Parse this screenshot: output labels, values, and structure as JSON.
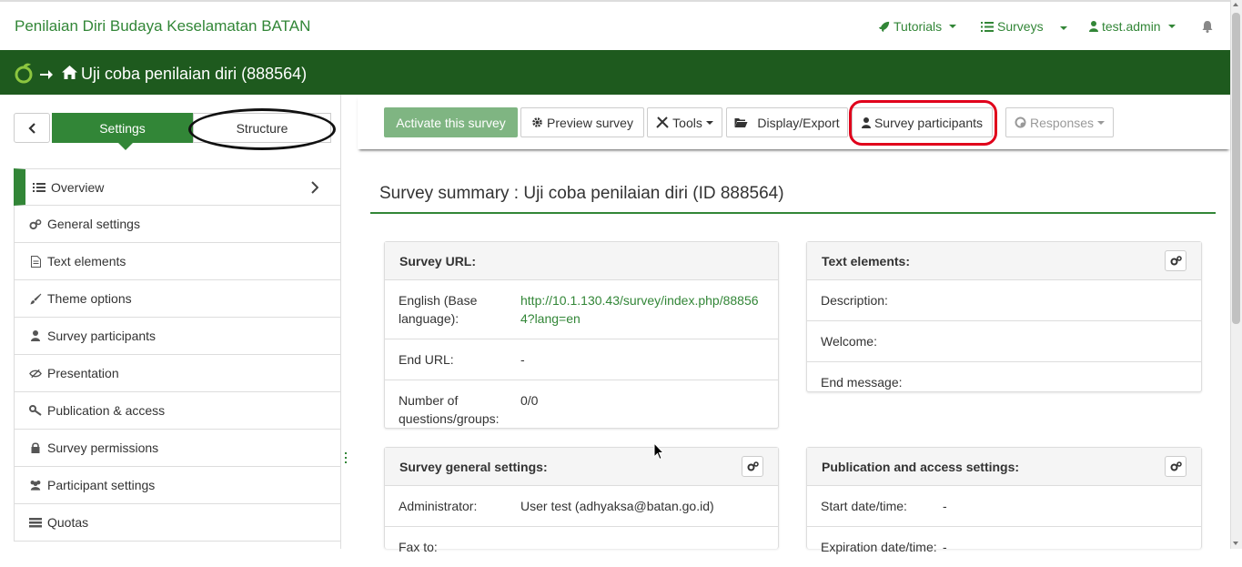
{
  "topbar": {
    "brand": "Penilaian Diri Budaya Keselamatan BATAN",
    "tutorials": "Tutorials",
    "surveys": "Surveys",
    "user": "test.admin"
  },
  "header": {
    "title": "Uji coba penilaian diri (888564)"
  },
  "sidebar": {
    "tab_settings": "Settings",
    "tab_structure": "Structure",
    "items": [
      {
        "label": "Overview",
        "icon": "list-icon"
      },
      {
        "label": "General settings",
        "icon": "gears-icon"
      },
      {
        "label": "Text elements",
        "icon": "file-text-icon"
      },
      {
        "label": "Theme options",
        "icon": "paint-brush-icon"
      },
      {
        "label": "Survey participants",
        "icon": "user-icon"
      },
      {
        "label": "Presentation",
        "icon": "eye-slash-icon"
      },
      {
        "label": "Publication & access",
        "icon": "key-icon"
      },
      {
        "label": "Survey permissions",
        "icon": "lock-icon"
      },
      {
        "label": "Participant settings",
        "icon": "users-icon"
      },
      {
        "label": "Quotas",
        "icon": "tasks-icon"
      }
    ]
  },
  "toolbar": {
    "activate": "Activate this survey",
    "preview": "Preview survey",
    "tools": "Tools",
    "display_export": "Display/Export",
    "survey_participants": "Survey participants",
    "responses": "Responses"
  },
  "summary": {
    "title": "Survey summary : Uji coba penilaian diri (ID 888564)",
    "survey_url": {
      "heading": "Survey URL:",
      "rows": [
        {
          "key": "English (Base language):",
          "value": "http://10.1.130.43/survey/index.php/888564?lang=en"
        },
        {
          "key": "End URL:",
          "value": "-"
        },
        {
          "key": "Number of questions/groups:",
          "value": "0/0"
        }
      ]
    },
    "text_elements": {
      "heading": "Text elements:",
      "rows": [
        {
          "key": "Description:",
          "value": ""
        },
        {
          "key": "Welcome:",
          "value": ""
        },
        {
          "key": "End message:",
          "value": ""
        }
      ]
    },
    "general_settings": {
      "heading": "Survey general settings:",
      "rows": [
        {
          "key": "Administrator:",
          "value": "User test (adhyaksa@batan.go.id)"
        },
        {
          "key": "Fax to:",
          "value": ""
        }
      ]
    },
    "publication": {
      "heading": "Publication and access settings:",
      "rows": [
        {
          "key": "Start date/time:",
          "value": "-"
        },
        {
          "key": "Expiration date/time:",
          "value": "-"
        }
      ]
    }
  },
  "colors": {
    "brand_green": "#328637",
    "header_dark_green": "#1e5a1e",
    "annotation_red": "#e0001b",
    "annotation_black": "#111111"
  }
}
